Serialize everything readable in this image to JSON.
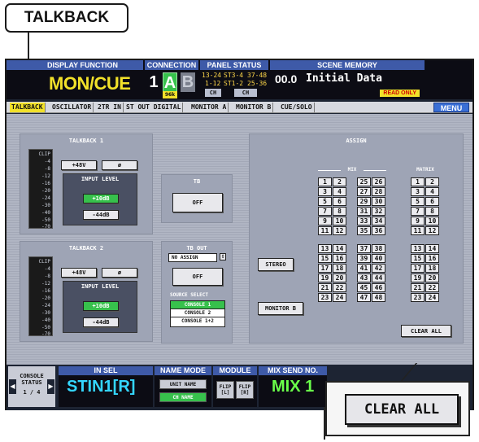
{
  "callout": {
    "label": "TALKBACK"
  },
  "topbar": {
    "display_function_hdr": "DISPLAY FUNCTION",
    "display_function": "MON/CUE",
    "connection_hdr": "CONNECTION",
    "conn_1": "1",
    "conn_a": "A",
    "conn_b": "B",
    "conn_rate": "96k",
    "panel_status_hdr": "PANEL STATUS",
    "ps_line1a": "13-24",
    "ps_line1b": "ST3-4",
    "ps_line1c": "37-48",
    "ps_line2a": "1-12",
    "ps_line2b": "ST1-2",
    "ps_line2c": "25-36",
    "ps_ch1": "CH",
    "ps_ch2": "CH",
    "scene_memory_hdr": "SCENE MEMORY",
    "scene_number": "00.0",
    "scene_title": "Initial Data",
    "read_only": "READ ONLY"
  },
  "tabs": [
    "TALKBACK",
    "OSCILLATOR",
    "2TR IN",
    "ST OUT DIGITAL",
    "MONITOR A",
    "MONITOR B",
    "CUE/SOLO"
  ],
  "menu_label": "MENU",
  "talkback1": {
    "title": "TALKBACK 1",
    "btn_48v": "+48V",
    "btn_phase": "ø",
    "input_level": "INPUT LEVEL",
    "btn_10db": "+10dB",
    "btn_44db": "-44dB"
  },
  "talkback2": {
    "title": "TALKBACK 2",
    "btn_48v": "+48V",
    "btn_phase": "ø",
    "input_level": "INPUT LEVEL",
    "btn_10db": "+10dB",
    "btn_44db": "-44dB"
  },
  "meter_labels": [
    "CLIP",
    "-4",
    "-8",
    "-12",
    "-16",
    "-20",
    "-24",
    "-30",
    "-40",
    "-50",
    "-70"
  ],
  "tb": {
    "title": "TB",
    "button": "OFF"
  },
  "tb_out": {
    "title": "TB OUT",
    "dropdown": "NO ASSIGN",
    "button": "OFF",
    "source_select": "SOURCE SELECT",
    "sources": [
      "CONSOLE 1",
      "CONSOLE 2",
      "CONSOLE 1+2"
    ]
  },
  "assign": {
    "title": "ASSIGN",
    "mix_label": "MIX",
    "matrix_label": "MATRIX",
    "stereo": "STEREO",
    "monitor_b": "MONITOR B",
    "clear_all": "CLEAR ALL",
    "mix_col1": [
      "1",
      "2",
      "3",
      "4",
      "5",
      "6",
      "7",
      "8",
      "9",
      "10",
      "11",
      "12"
    ],
    "mix_col2": [
      "25",
      "26",
      "27",
      "28",
      "29",
      "30",
      "31",
      "32",
      "33",
      "34",
      "35",
      "36"
    ],
    "mix_col3": [
      "13",
      "14",
      "15",
      "16",
      "17",
      "18",
      "19",
      "20",
      "21",
      "22",
      "23",
      "24"
    ],
    "mix_col4": [
      "37",
      "38",
      "39",
      "40",
      "41",
      "42",
      "43",
      "44",
      "45",
      "46",
      "47",
      "48"
    ],
    "matrix_top": [
      "1",
      "2",
      "3",
      "4",
      "5",
      "6",
      "7",
      "8",
      "9",
      "10",
      "11",
      "12"
    ],
    "matrix_bottom": [
      "13",
      "14",
      "15",
      "16",
      "17",
      "18",
      "19",
      "20",
      "21",
      "22",
      "23",
      "24"
    ]
  },
  "bottombar": {
    "console_status": "CONSOLE STATUS",
    "console_page": "1 / 4",
    "in_sel_hdr": "IN SEL",
    "in_sel_val": "STIN1[R]",
    "name_mode_hdr": "NAME MODE",
    "unit_name": "UNIT NAME",
    "ch_name": "CH NAME",
    "module_hdr": "MODULE",
    "flip_l": "FLIP [L]",
    "flip_r": "FLIP [R]",
    "mix_send_hdr": "MIX SEND NO.",
    "mix_send_val": "MIX 1"
  },
  "zoom": {
    "label": "CLEAR ALL"
  }
}
